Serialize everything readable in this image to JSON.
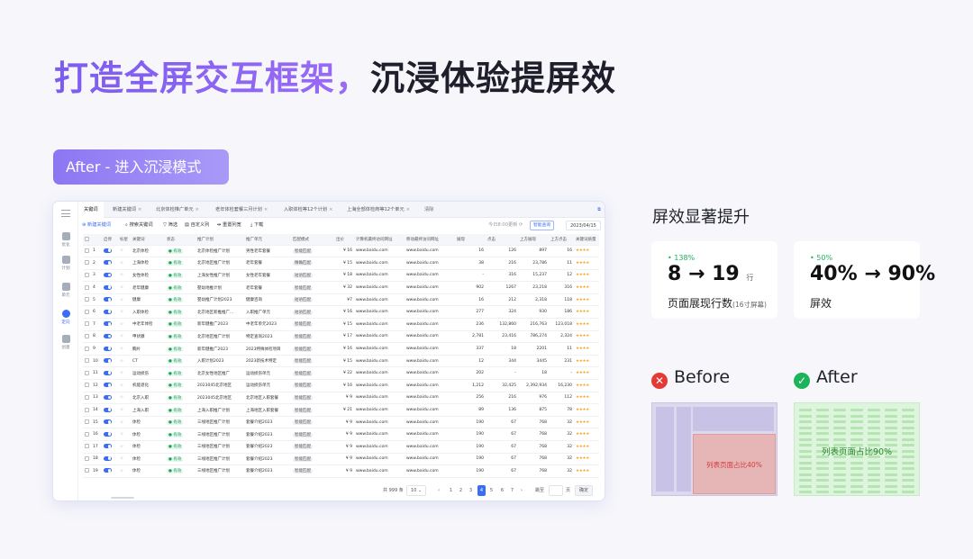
{
  "headline": {
    "accent": "打造全屏交互框架，",
    "rest": "沉浸体验提屏效"
  },
  "after_pill": "After - 进入沉浸模式",
  "app": {
    "rail": [
      {
        "label": "优化",
        "icon": "rocket-icon"
      },
      {
        "label": "计划",
        "icon": "plan-icon"
      },
      {
        "label": "单元",
        "icon": "unit-icon"
      },
      {
        "label": "定向",
        "icon": "target-icon"
      },
      {
        "label": "创意",
        "icon": "creative-icon"
      }
    ],
    "tabs": [
      "关键词",
      "新建关键词",
      "北京体检推广单元",
      "老年体检套餐三月计划",
      "入职体检等12个计划",
      "上海全部体检商等12个单元",
      "清除"
    ],
    "toolbar": {
      "new": "新建关键词",
      "search": "搜索关键词",
      "filter": "筛选",
      "custom_cols": "自定义列",
      "reset_width": "重置列宽",
      "download": "下载",
      "updated": "今日8:00更新",
      "smart": "智能查询",
      "date": "2023/04/15"
    },
    "columns": [
      "",
      "",
      "启停",
      "标星",
      "关键词",
      "状态",
      "推广计划",
      "推广单元",
      "匹配模式",
      "出价",
      "计算机最终访问网址",
      "移动最终访问网址",
      "展现",
      "点击",
      "上方展现",
      "上方点击",
      "关键词质量"
    ],
    "rows": [
      [
        "1",
        "北京体检",
        "有效",
        "北京体检推广计划",
        "男性老年套餐",
        "智能匹配",
        "¥ 16",
        "www.baidu.com",
        "www.baidu.com",
        "16",
        "126",
        "897",
        "16"
      ],
      [
        "2",
        "上海体检",
        "有效",
        "北京地区推广计划",
        "老年套餐",
        "精确匹配",
        "¥ 15",
        "www.baidu.com",
        "www.baidu.com",
        "38",
        "216",
        "23,786",
        "11"
      ],
      [
        "3",
        "女性体检",
        "有效",
        "上海女性推广计划",
        "女性老年套餐",
        "短语匹配",
        "¥ 18",
        "www.baidu.com",
        "www.baidu.com",
        "-",
        "316",
        "15,237",
        "12"
      ],
      [
        "4",
        "老年健康",
        "有效",
        "婴幼地推计划",
        "老年套餐",
        "智能匹配",
        "¥ 32",
        "www.baidu.com",
        "www.baidu.com",
        "902",
        "1267",
        "23,218",
        "316"
      ],
      [
        "5",
        "健康",
        "有效",
        "婴幼推广计划2023",
        "健康咨询",
        "短语匹配",
        "¥7",
        "www.baidu.com",
        "www.baidu.com",
        "16",
        "212",
        "2,318",
        "118"
      ],
      [
        "6",
        "入职体检",
        "有效",
        "北京地区新推推广...",
        "入职推广单元",
        "短语匹配",
        "¥ 16",
        "www.baidu.com",
        "www.baidu.com",
        "277",
        "324",
        "930",
        "186"
      ],
      [
        "7",
        "中老年体检",
        "有效",
        "新年健推广2023",
        "中老年单元2023",
        "智能匹配",
        "¥ 15",
        "www.baidu.com",
        "www.baidu.com",
        "236",
        "132,860",
        "216,763",
        "123,018"
      ],
      [
        "8",
        "甲状腺",
        "有效",
        "北京地区推广计划",
        "特定查询2023",
        "智能匹配",
        "¥ 17",
        "www.baidu.com",
        "www.baidu.com",
        "2,781",
        "23,416",
        "786,274",
        "2,324"
      ],
      [
        "9",
        "胸片",
        "有效",
        "新年健推广2023",
        "2023特殊体检项目",
        "智能匹配",
        "¥ 16",
        "www.baidu.com",
        "www.baidu.com",
        "337",
        "18",
        "2201",
        "11"
      ],
      [
        "10",
        "CT",
        "有效",
        "入职计划2023",
        "2023新技术特定",
        "智能匹配",
        "¥ 15",
        "www.baidu.com",
        "www.baidu.com",
        "12",
        "344",
        "3445",
        "231"
      ],
      [
        "11",
        "运动损伤",
        "有效",
        "北京女性地区推广",
        "运动损伤单元",
        "智能匹配",
        "¥ 22",
        "www.baidu.com",
        "www.baidu.com",
        "202",
        "-",
        "18",
        "-"
      ],
      [
        "12",
        "机能退化",
        "有效",
        "2023045北京地区",
        "运动损伤单元",
        "智能匹配",
        "¥ 16",
        "www.baidu.com",
        "www.baidu.com",
        "1,212",
        "32,425",
        "2,392,934",
        "16,230"
      ],
      [
        "13",
        "北京入职",
        "有效",
        "2023045北京地区",
        "北京地区入职套餐",
        "智能匹配",
        "¥ 9",
        "www.baidu.com",
        "www.baidu.com",
        "256",
        "216",
        "976",
        "112"
      ],
      [
        "14",
        "上海入职",
        "有效",
        "上海入职推广计划",
        "上海地区入职套餐",
        "智能匹配",
        "¥ 21",
        "www.baidu.com",
        "www.baidu.com",
        "89",
        "136",
        "875",
        "78"
      ],
      [
        "15",
        "体检",
        "有效",
        "三线地区推广计划",
        "套餐介绍2023",
        "智能匹配",
        "¥ 9",
        "www.baidu.com",
        "www.baidu.com",
        "190",
        "67",
        "768",
        "32"
      ],
      [
        "16",
        "体检",
        "有效",
        "三线地区推广计划",
        "套餐介绍2023",
        "智能匹配",
        "¥ 9",
        "www.baidu.com",
        "www.baidu.com",
        "190",
        "67",
        "768",
        "32"
      ],
      [
        "17",
        "体检",
        "有效",
        "三线地区推广计划",
        "套餐介绍2023",
        "智能匹配",
        "¥ 9",
        "www.baidu.com",
        "www.baidu.com",
        "190",
        "67",
        "768",
        "32"
      ],
      [
        "18",
        "体检",
        "有效",
        "三线地区推广计划",
        "套餐介绍2023",
        "智能匹配",
        "¥ 9",
        "www.baidu.com",
        "www.baidu.com",
        "190",
        "67",
        "768",
        "32"
      ],
      [
        "19",
        "体检",
        "有效",
        "三线地区推广计划",
        "套餐介绍2023",
        "智能匹配",
        "¥ 9",
        "www.baidu.com",
        "www.baidu.com",
        "190",
        "67",
        "768",
        "32"
      ]
    ],
    "stars": "★★★★",
    "pagination": {
      "total": "共 999 条",
      "per_page": "10",
      "prev": "‹",
      "pages": [
        "1",
        "2",
        "3",
        "4",
        "5",
        "6",
        "7"
      ],
      "current": "4",
      "next": "›",
      "goto": "跳至",
      "page_suffix": "页",
      "confirm": "确定"
    }
  },
  "side": {
    "title": "屏效显著提升",
    "metrics": [
      {
        "delta": "• 138%",
        "from": "8",
        "arrow": "→",
        "to": "19",
        "unit": "行",
        "label": "页面展现行数",
        "note": "(16寸屏幕)"
      },
      {
        "delta": "• 50%",
        "from": "40%",
        "arrow": "→",
        "to": "90%",
        "unit": "",
        "label": "屏效",
        "note": ""
      }
    ],
    "before": {
      "label": "Before",
      "icon": "✕",
      "color": "#e53935",
      "mock_caption": "列表页面占比40%"
    },
    "after": {
      "label": "After",
      "icon": "✓",
      "color": "#1db35b",
      "mock_caption": "列表页面占比90%"
    }
  }
}
